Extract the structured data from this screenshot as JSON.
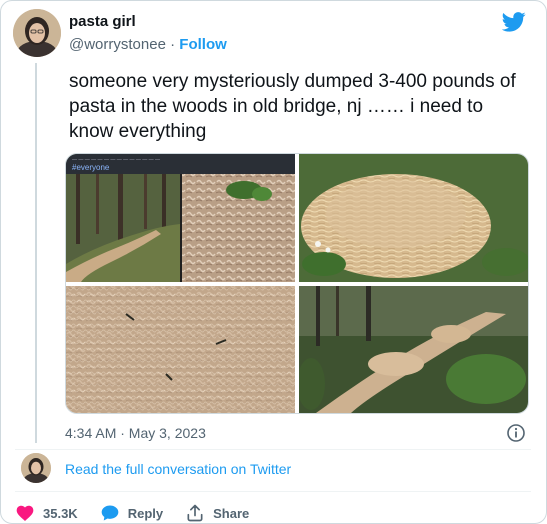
{
  "author": {
    "display_name": "pasta girl",
    "handle": "@worrystonee",
    "separator": "·",
    "follow_label": "Follow"
  },
  "tweet": {
    "text": "someone very mysteriously dumped 3-400 pounds of pasta in the woods in old bridge, nj …… i need to know everything",
    "media": {
      "overlay_caption": "#everyone",
      "image_count": 4
    },
    "timestamp": "4:34 AM · May 3, 2023"
  },
  "conversation_link": "Read the full conversation on Twitter",
  "actions": {
    "likes": "35.3K",
    "reply_label": "Reply",
    "share_label": "Share"
  },
  "colors": {
    "brand_blue": "#1d9bf0",
    "like_pink": "#f91880",
    "secondary_text": "#536471"
  },
  "icons": [
    "twitter-bird-icon",
    "info-icon",
    "heart-icon",
    "reply-bubble-icon",
    "share-icon"
  ]
}
